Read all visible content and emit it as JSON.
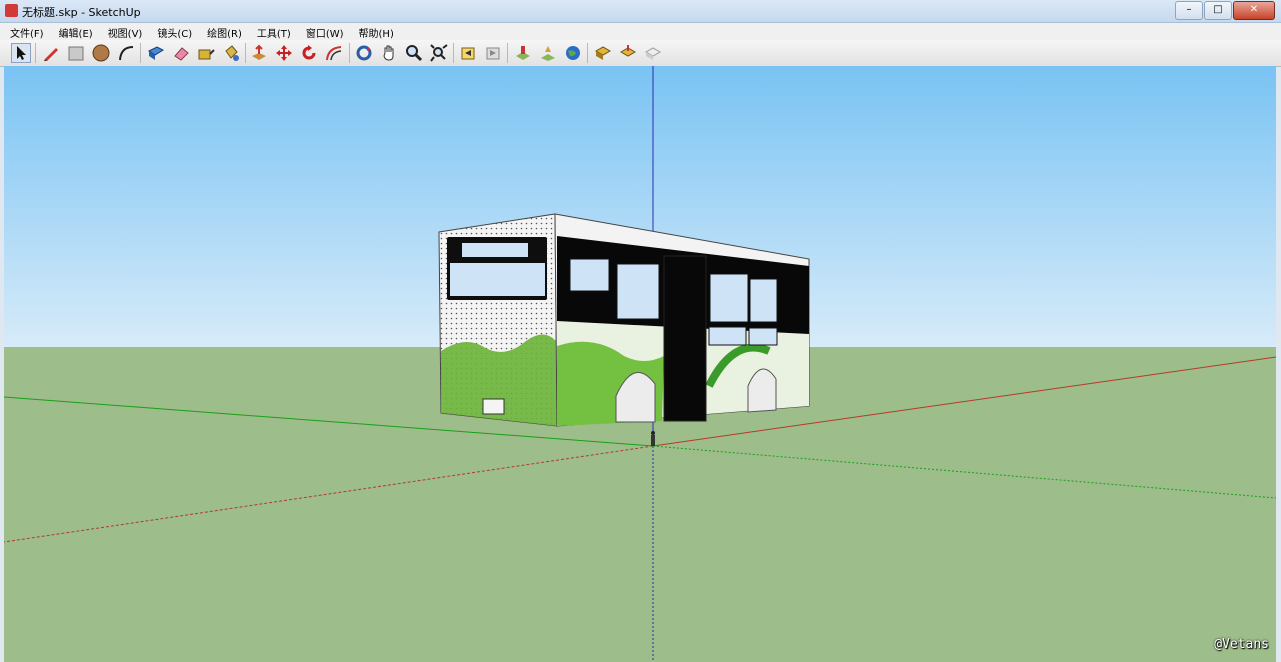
{
  "window": {
    "title": "无标题.skp - SketchUp",
    "minimize": "–",
    "maximize": "□",
    "close": "✕"
  },
  "menu": [
    "文件(F)",
    "编辑(E)",
    "视图(V)",
    "镜头(C)",
    "绘图(R)",
    "工具(T)",
    "窗口(W)",
    "帮助(H)"
  ],
  "toolbar": [
    "select-icon",
    "pencil-icon",
    "rectangle-icon",
    "circle-icon",
    "arc-icon",
    "make-component-icon",
    "eraser-icon",
    "tape-measure-icon",
    "paint-bucket-icon",
    "push-pull-icon",
    "move-icon",
    "rotate-icon",
    "offset-icon",
    "orbit-icon",
    "pan-icon",
    "zoom-icon",
    "zoom-extents-icon",
    "previous-view-icon",
    "next-view-icon",
    "add-location-icon",
    "toggle-terrain-icon",
    "google-earth-icon",
    "get-models-icon",
    "share-model-icon",
    "share-component-icon"
  ],
  "colors": {
    "sky_top": "#79c3f3",
    "sky_bottom": "#d7ebf9",
    "ground": "#9dbd8a",
    "axis_red": "#b53a2a",
    "axis_green": "#19a019",
    "axis_blue": "#2c2cb0"
  },
  "watermark": "@Vetans"
}
